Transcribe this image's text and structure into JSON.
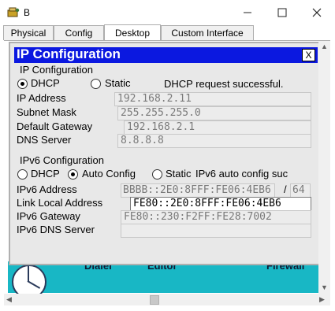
{
  "window": {
    "title": "B"
  },
  "tabs": [
    "Physical",
    "Config",
    "Desktop",
    "Custom Interface"
  ],
  "desktop_apps": {
    "dialer": "Dialer",
    "editor": "Editor",
    "firewall": "Firewall"
  },
  "ip_config": {
    "title": "IP Configuration",
    "close_label": "X",
    "ipv4": {
      "group_label": "IP Configuration",
      "dhcp_label": "DHCP",
      "static_label": "Static",
      "mode_selected": "DHCP",
      "status": "DHCP request successful.",
      "ip_address_label": "IP Address",
      "ip_address": "192.168.2.11",
      "subnet_mask_label": "Subnet Mask",
      "subnet_mask": "255.255.255.0",
      "default_gateway_label": "Default Gateway",
      "default_gateway": "192.168.2.1",
      "dns_server_label": "DNS Server",
      "dns_server": "8.8.8.8"
    },
    "ipv6": {
      "group_label": "IPv6 Configuration",
      "dhcp_label": "DHCP",
      "auto_config_label": "Auto Config",
      "static_label": "Static",
      "mode_selected": "Auto Config",
      "status": "IPv6 auto config suc",
      "ipv6_address_label": "IPv6 Address",
      "ipv6_address": "BBBB::2E0:8FFF:FE06:4EB6",
      "prefix_separator": "/",
      "prefix_length": "64",
      "link_local_label": "Link Local Address",
      "link_local_address": "FE80::2E0:8FFF:FE06:4EB6",
      "ipv6_gateway_label": "IPv6 Gateway",
      "ipv6_gateway": "FE80::230:F2FF:FE28:7002",
      "ipv6_dns_label": "IPv6 DNS Server",
      "ipv6_dns": ""
    }
  }
}
